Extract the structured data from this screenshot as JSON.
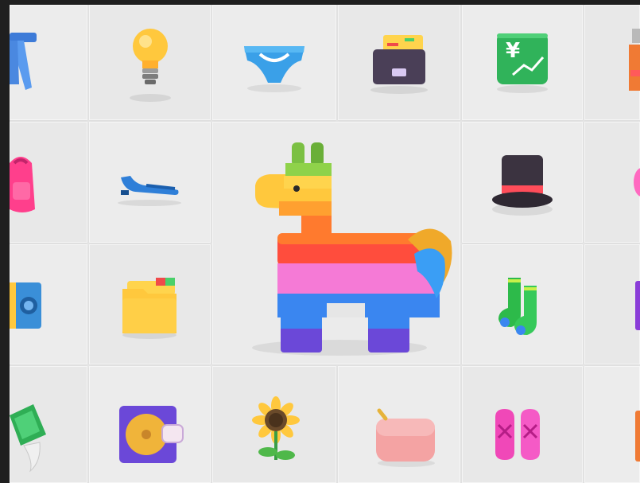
{
  "gallery": {
    "tiles": [
      {
        "icon": "jeans-icon"
      },
      {
        "icon": "light-bulb-icon"
      },
      {
        "icon": "briefs-icon"
      },
      {
        "icon": "card-file-box-icon"
      },
      {
        "icon": "chart-increasing-with-yen-icon"
      },
      {
        "icon": "bottle-icon"
      },
      {
        "icon": "backpack-icon"
      },
      {
        "icon": "flat-shoe-icon"
      },
      {
        "icon": "pinata-icon"
      },
      {
        "icon": "top-hat-icon"
      },
      {
        "icon": "partial-pink-icon"
      },
      {
        "icon": "banknote-icon"
      },
      {
        "icon": "file-folder-icon"
      },
      {
        "icon": "socks-icon"
      },
      {
        "icon": "partial-purple-icon"
      },
      {
        "icon": "money-with-wings-icon"
      },
      {
        "icon": "minidisc-icon"
      },
      {
        "icon": "sunflower-icon"
      },
      {
        "icon": "clutch-bag-icon"
      },
      {
        "icon": "ballet-shoes-icon"
      },
      {
        "icon": "partial-orange-icon"
      }
    ],
    "colors": {
      "background": "#1f1f1f",
      "tile": "#ececec"
    }
  }
}
